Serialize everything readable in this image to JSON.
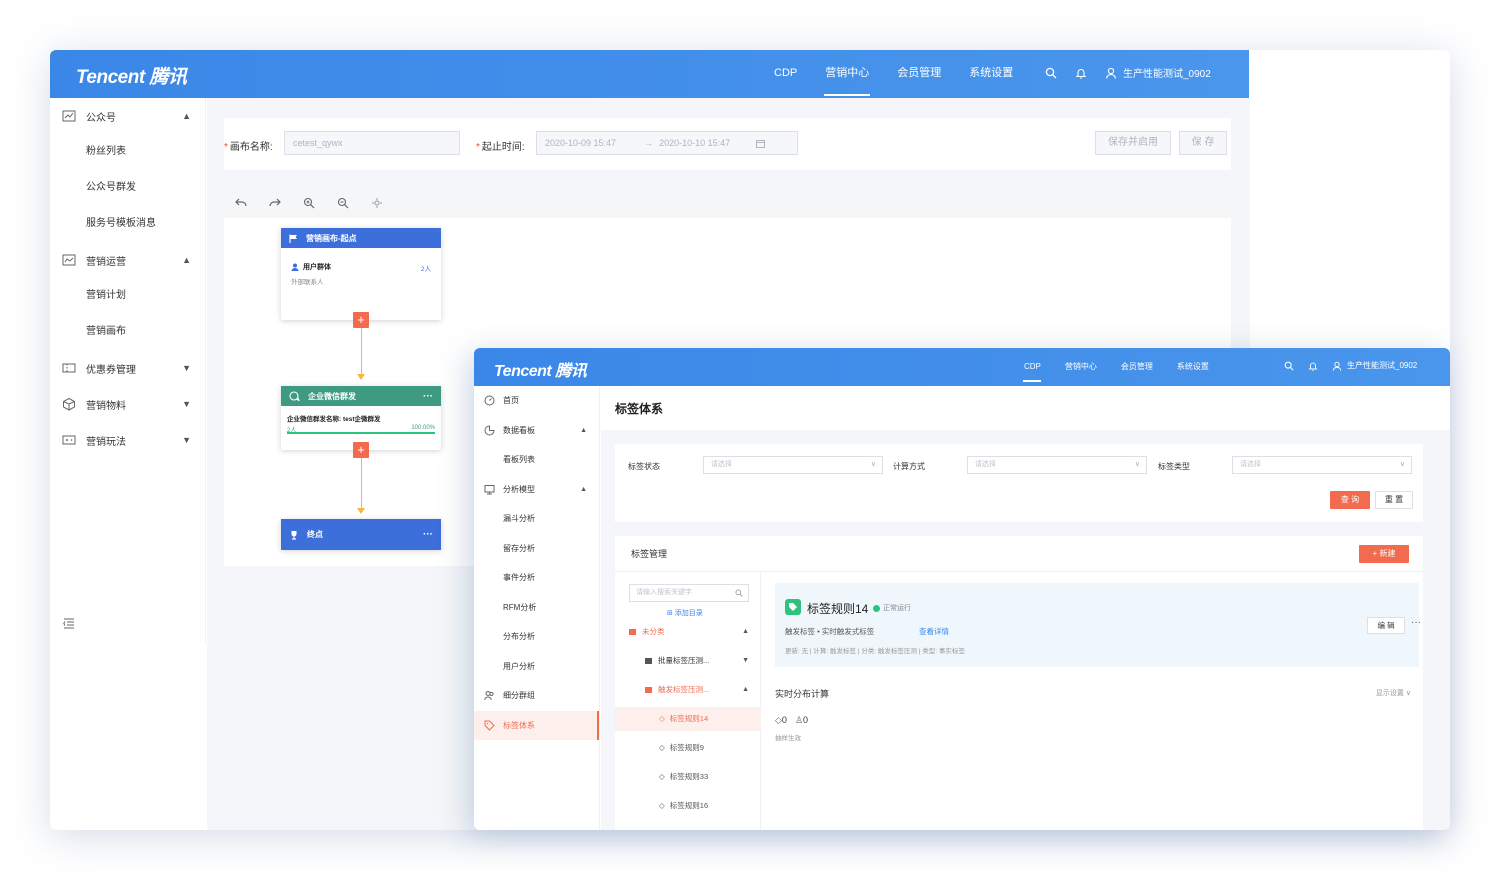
{
  "win1": {
    "logo": "Tencent 腾讯",
    "nav": [
      "CDP",
      "营销中心",
      "会员管理",
      "系统设置"
    ],
    "nav_active": "营销中心",
    "username": "生产性能测试_0902",
    "sidebar": {
      "groups": [
        {
          "label": "公众号",
          "expanded": true,
          "icon": "chart-icon",
          "items": [
            "粉丝列表",
            "公众号群发",
            "服务号模板消息"
          ]
        },
        {
          "label": "营销运营",
          "expanded": true,
          "icon": "trend-icon",
          "items": [
            "营销计划",
            "营销画布"
          ]
        },
        {
          "label": "优惠券管理",
          "expanded": false,
          "icon": "coupon-icon",
          "items": []
        },
        {
          "label": "营销物料",
          "expanded": false,
          "icon": "box-icon",
          "items": []
        },
        {
          "label": "营销玩法",
          "expanded": false,
          "icon": "gamepad-icon",
          "items": []
        }
      ]
    },
    "form": {
      "canvas_name_label": "画布名称:",
      "canvas_name_value": "cetest_qywx",
      "time_label": "起止时间:",
      "start_time": "2020-10-09 15:47",
      "end_time": "2020-10-10 15:47",
      "save_enable_label": "保存并启用",
      "save_label": "保 存"
    },
    "nodes": {
      "start": {
        "title": "营销画布-起点",
        "audience_label": "用户群体",
        "audience_count": "2人",
        "audience_desc": "外部联系人"
      },
      "group": {
        "title": "企业微信群发",
        "desc": "企业微信群发名称: test企微群发",
        "count": "2人",
        "percent": "100.00%",
        "progress": 100
      },
      "end": {
        "title": "终点"
      }
    },
    "colors": {
      "start": "#3d6fdb",
      "group": "#3f9a82",
      "end": "#3d6fdb"
    }
  },
  "win2": {
    "logo": "Tencent 腾讯",
    "nav": [
      "CDP",
      "营销中心",
      "会员管理",
      "系统设置"
    ],
    "nav_active": "CDP",
    "username": "生产性能测试_0902",
    "sidebar": [
      {
        "type": "group",
        "label": "首页",
        "icon": "dashboard-icon"
      },
      {
        "type": "group",
        "label": "数据看板",
        "icon": "pie-icon",
        "chev": "▲"
      },
      {
        "type": "sub",
        "label": "看板列表"
      },
      {
        "type": "group",
        "label": "分析模型",
        "icon": "monitor-icon",
        "chev": "▲"
      },
      {
        "type": "sub",
        "label": "漏斗分析"
      },
      {
        "type": "sub",
        "label": "留存分析"
      },
      {
        "type": "sub",
        "label": "事件分析"
      },
      {
        "type": "sub",
        "label": "RFM分析"
      },
      {
        "type": "sub",
        "label": "分布分析"
      },
      {
        "type": "sub",
        "label": "用户分析"
      },
      {
        "type": "group",
        "label": "细分群组",
        "icon": "users-icon"
      },
      {
        "type": "group",
        "label": "标签体系",
        "icon": "tag-icon",
        "active": true
      }
    ],
    "page_title": "标签体系",
    "filters": [
      {
        "label": "标签状态",
        "placeholder": "请选择"
      },
      {
        "label": "计算方式",
        "placeholder": "请选择"
      },
      {
        "label": "标签类型",
        "placeholder": "请选择"
      }
    ],
    "query_label": "查 询",
    "reset_label": "重 置",
    "mgmt_title": "标签管理",
    "new_label": "+ 新建",
    "search_placeholder": "请输入搜索关键字",
    "add_dir": "⊞ 添加目录",
    "tree": [
      {
        "label": "未分类",
        "level": 0,
        "chev": "▲",
        "folder": true
      },
      {
        "label": "批量标签压测...",
        "level": 1,
        "chev": "▼",
        "folder": true
      },
      {
        "label": "触发标签压测...",
        "level": 1,
        "chev": "▲",
        "folder": true
      },
      {
        "label": "标签规则14",
        "level": 2,
        "selected": true
      },
      {
        "label": "标签规则9",
        "level": 2
      },
      {
        "label": "标签规则33",
        "level": 2
      },
      {
        "label": "标签规则16",
        "level": 2
      }
    ],
    "detail": {
      "title": "标签规则14",
      "status": "正常运行",
      "meta": "触发标签 • 实时触发式标签",
      "link": "查看详情",
      "update": "更新: 无 | 计算: 触发标签 | 分类: 触发标签压测 | 类型: 事实标签",
      "edit": "编 辑",
      "section": "实时分布计算",
      "display_setting": "显示设置 ∨",
      "count_a": "0",
      "count_b": "0",
      "count_note": "抽样生效"
    }
  }
}
